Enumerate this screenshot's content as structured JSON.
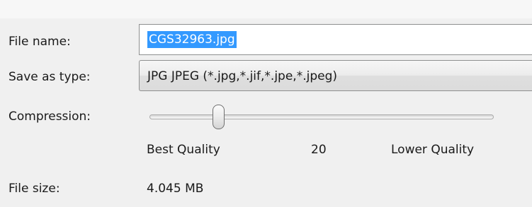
{
  "file_name": {
    "label": "File name:",
    "value": "CGS32963.jpg"
  },
  "save_as_type": {
    "label": "Save as type:",
    "selected": "JPG JPEG  (*.jpg,*.jif,*.jpe,*.jpeg)"
  },
  "compression": {
    "label": "Compression:",
    "min_label": "Best Quality",
    "max_label": "Lower Quality",
    "value": "20",
    "min": 0,
    "max": 100,
    "position": 20
  },
  "file_size": {
    "label": "File size:",
    "value": "4.045 MB"
  },
  "colors": {
    "selection": "#3399ff",
    "background": "#f0f0f0"
  }
}
